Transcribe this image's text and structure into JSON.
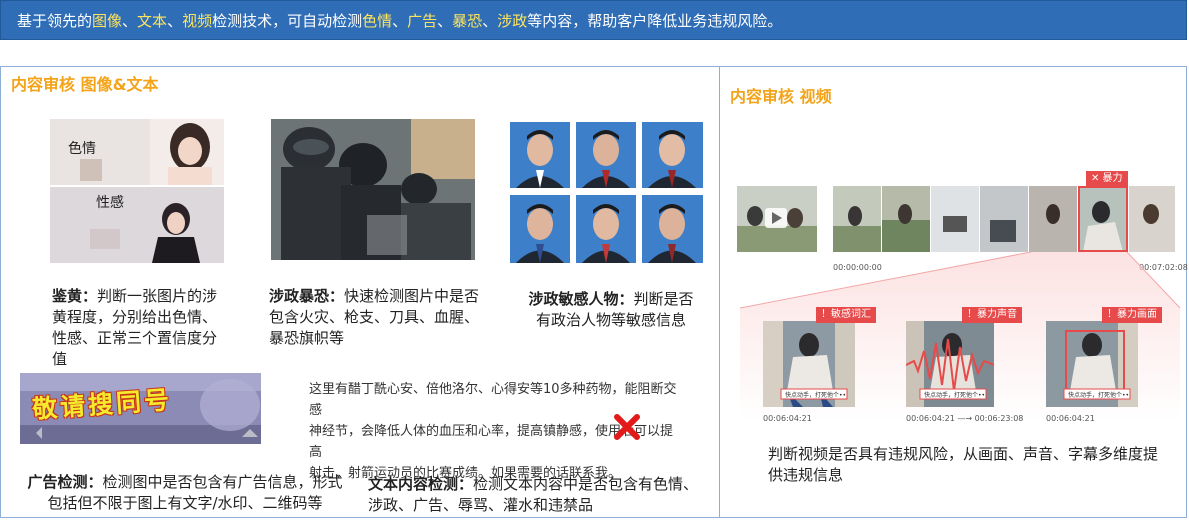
{
  "banner": {
    "prefix": "基于领先的",
    "hl1": "图像",
    "sep1": "、",
    "hl2": "文本",
    "sep2": "、",
    "hl3": "视频",
    "mid": "检测技术，可自动检测",
    "hl4": "色情",
    "sep3": "、",
    "hl5": "广告",
    "sep4": "、",
    "hl6": "暴恐",
    "sep5": "、",
    "hl7": "涉政",
    "suffix": "等内容，帮助客户降低业务违规风险。"
  },
  "left_panel": {
    "title": "内容审核 图像&文本",
    "porn": {
      "label1": "色情",
      "label2": "性感",
      "title": "鉴黄：",
      "desc": "判断一张图片的涉黄程度，分别给出色情、性感、正常三个置信度分值"
    },
    "terror": {
      "title": "涉政暴恐：",
      "desc": "快速检测图片中是否包含火灾、枪支、刀具、血腥、暴恐旗帜等"
    },
    "politician": {
      "title": "涉政敏感人物：",
      "desc": "判断是否有政治人物等敏感信息"
    },
    "ad": {
      "image_text": "敬请搜同号",
      "title": "广告检测：",
      "desc": "检测图中是否包含有广告信息，形式包括但不限于图上有文字/水印、二维码等"
    },
    "text_sample": {
      "line1": "这里有醋丁酰心安、倍他洛尔、心得安等10多种药物，能阻断交感",
      "line2": "神经节，会降低人体的血压和心率，提高镇静感，使用后可以提高",
      "line3": "射击、射箭运动员的比赛成绩。如果需要的话联系我。"
    },
    "text": {
      "title": "文本内容检测：",
      "desc": "检测文本内容中是否包含有色情、涉政、广告、辱骂、灌水和违禁品"
    }
  },
  "right_panel": {
    "title": "内容审核 视频",
    "timeline_tag": "✕ 暴力",
    "time_start": "00:00:00:00",
    "time_end": "00:07:02:08",
    "frames": [
      {
        "tag": "！敏感词汇",
        "caption": "快点动手，打死他个••",
        "time": "00:06:04:21"
      },
      {
        "tag": "！暴力声音",
        "caption": "快点动手，打死他个••",
        "time": "00:06:04:21 —→ 00:06:23:08"
      },
      {
        "tag": "！暴力画面",
        "caption": "快点动手，打死他个••",
        "time": "00:06:04:21"
      }
    ],
    "desc": "判断视频是否具有违规风险，从画面、声音、字幕多维度提供违规信息"
  },
  "colors": {
    "banner": "#2f6eb6",
    "highlight": "#ffe45c",
    "title": "#f3a41b",
    "alert": "#e74a4a",
    "border": "#8fb0d6"
  }
}
